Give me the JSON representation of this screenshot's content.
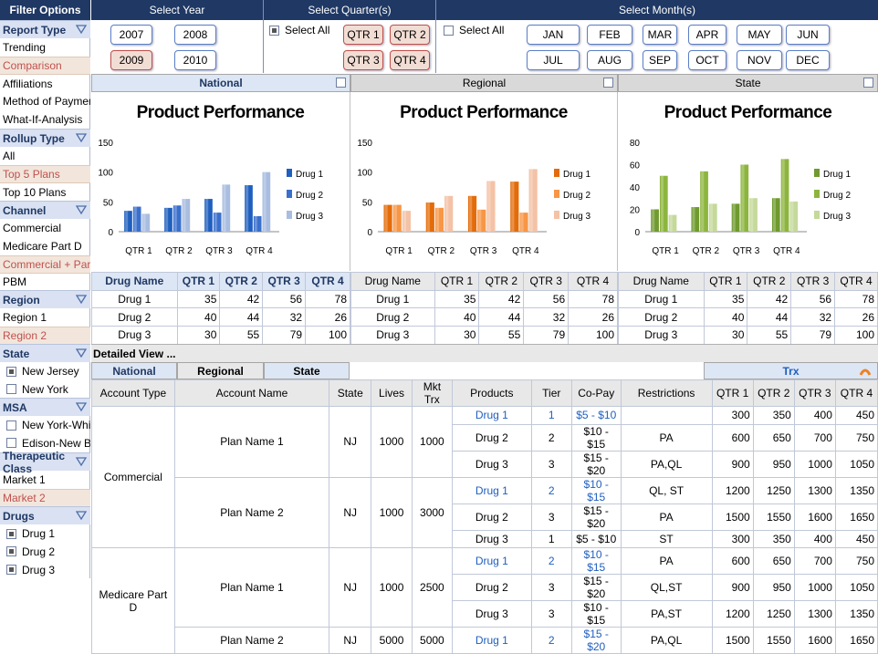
{
  "sidebar": {
    "title": "Filter Options",
    "report_type": {
      "label": "Report Type",
      "items": [
        "Trending",
        "Comparison",
        "Affiliations",
        "Method of Payment",
        "What-If-Analysis"
      ]
    },
    "rollup_type": {
      "label": "Rollup Type",
      "items": [
        "All",
        "Top 5 Plans",
        "Top 10 Plans"
      ]
    },
    "channel": {
      "label": "Channel",
      "items": [
        "Commercial",
        "Medicare Part D",
        "Commercial + Part D",
        "PBM"
      ]
    },
    "region": {
      "label": "Region",
      "items": [
        "Region 1",
        "Region 2"
      ]
    },
    "state": {
      "label": "State",
      "items": [
        "New Jersey",
        "New York"
      ]
    },
    "msa": {
      "label": "MSA",
      "items": [
        "New York-White",
        "Edison-New Bru"
      ]
    },
    "therapeutic": {
      "label": "Therapeutic Class",
      "items": [
        "Market 1",
        "Market 2"
      ]
    },
    "drugs": {
      "label": "Drugs",
      "items": [
        "Drug 1",
        "Drug 2",
        "Drug 3"
      ]
    }
  },
  "filters": {
    "year": {
      "label": "Select Year",
      "options": [
        "2007",
        "2008",
        "2009",
        "2010"
      ]
    },
    "quarter": {
      "label": "Select Quarter(s)",
      "select_all": "Select All",
      "options": [
        "QTR 1",
        "QTR 2",
        "QTR 3",
        "QTR 4"
      ]
    },
    "month": {
      "label": "Select Month(s)",
      "select_all": "Select All",
      "options": [
        "JAN",
        "FEB",
        "MAR",
        "APR",
        "MAY",
        "JUN",
        "JUL",
        "AUG",
        "SEP",
        "OCT",
        "NOV",
        "DEC"
      ]
    }
  },
  "panels": [
    "National",
    "Regional",
    "State"
  ],
  "chart_data": [
    {
      "type": "bar",
      "title": "Product Performance",
      "categories": [
        "QTR 1",
        "QTR 2",
        "QTR 3",
        "QTR 4"
      ],
      "ylim": [
        0,
        150
      ],
      "yticks": [
        0,
        50,
        100,
        150
      ],
      "series": [
        {
          "name": "Drug 1",
          "values": [
            35,
            40,
            55,
            78
          ]
        },
        {
          "name": "Drug 2",
          "values": [
            42,
            44,
            32,
            26
          ]
        },
        {
          "name": "Drug 3",
          "values": [
            30,
            55,
            79,
            100
          ]
        }
      ],
      "colors": [
        "#1f5fbf",
        "#3a6fcc",
        "#a9bde0"
      ]
    },
    {
      "type": "bar",
      "title": "Product Performance",
      "categories": [
        "QTR 1",
        "QTR 2",
        "QTR 3",
        "QTR 4"
      ],
      "ylim": [
        0,
        150
      ],
      "yticks": [
        0,
        50,
        100,
        150
      ],
      "series": [
        {
          "name": "Drug 1",
          "values": [
            45,
            49,
            60,
            84
          ]
        },
        {
          "name": "Drug 2",
          "values": [
            45,
            40,
            37,
            32
          ]
        },
        {
          "name": "Drug 3",
          "values": [
            35,
            60,
            85,
            105
          ]
        }
      ],
      "colors": [
        "#e36c0a",
        "#f79646",
        "#f4c2a6"
      ]
    },
    {
      "type": "bar",
      "title": "Product Performance",
      "categories": [
        "QTR 1",
        "QTR 2",
        "QTR 3",
        "QTR 4"
      ],
      "ylim": [
        0,
        80
      ],
      "yticks": [
        0,
        20,
        40,
        60,
        80
      ],
      "series": [
        {
          "name": "Drug 1",
          "values": [
            20,
            22,
            25,
            30
          ]
        },
        {
          "name": "Drug 2",
          "values": [
            50,
            54,
            60,
            65
          ]
        },
        {
          "name": "Drug 3",
          "values": [
            15,
            25,
            30,
            27
          ]
        }
      ],
      "colors": [
        "#6f9a2f",
        "#8db53e",
        "#c4d99a"
      ]
    }
  ],
  "summary": {
    "headers": [
      "Drug Name",
      "QTR 1",
      "QTR 2",
      "QTR 3",
      "QTR 4"
    ],
    "rows": [
      [
        "Drug 1",
        "35",
        "42",
        "56",
        "78"
      ],
      [
        "Drug 2",
        "40",
        "44",
        "32",
        "26"
      ],
      [
        "Drug 3",
        "30",
        "55",
        "79",
        "100"
      ]
    ]
  },
  "detail": {
    "title": "Detailed View ...",
    "tabs": [
      "National",
      "Regional",
      "State"
    ],
    "trx_label": "Trx",
    "headers": [
      "Account Type",
      "Account Name",
      "State",
      "Lives",
      "Mkt Trx",
      "Products",
      "Tier",
      "Co-Pay",
      "Restrictions",
      "QTR 1",
      "QTR 2",
      "QTR 3",
      "QTR 4"
    ],
    "groups": [
      {
        "type": "Commercial",
        "plans": [
          {
            "name": "Plan Name 1",
            "state": "NJ",
            "lives": "1000",
            "mkt": "1000",
            "rows": [
              [
                "Drug 1",
                "1",
                "$5 - $10",
                "",
                "300",
                "350",
                "400",
                "450"
              ],
              [
                "Drug 2",
                "2",
                "$10 - $15",
                "PA",
                "600",
                "650",
                "700",
                "750"
              ],
              [
                "Drug 3",
                "3",
                "$15 - $20",
                "PA,QL",
                "900",
                "950",
                "1000",
                "1050"
              ]
            ]
          },
          {
            "name": "Plan Name 2",
            "state": "NJ",
            "lives": "1000",
            "mkt": "3000",
            "rows": [
              [
                "Drug 1",
                "2",
                "$10 - $15",
                "QL, ST",
                "1200",
                "1250",
                "1300",
                "1350"
              ],
              [
                "Drug 2",
                "3",
                "$15 - $20",
                "PA",
                "1500",
                "1550",
                "1600",
                "1650"
              ],
              [
                "Drug 3",
                "1",
                "$5 - $10",
                "ST",
                "300",
                "350",
                "400",
                "450"
              ]
            ]
          }
        ]
      },
      {
        "type": "Medicare Part D",
        "plans": [
          {
            "name": "Plan Name 1",
            "state": "NJ",
            "lives": "1000",
            "mkt": "2500",
            "rows": [
              [
                "Drug 1",
                "2",
                "$10 - $15",
                "PA",
                "600",
                "650",
                "700",
                "750"
              ],
              [
                "Drug 2",
                "3",
                "$15 - $20",
                "QL,ST",
                "900",
                "950",
                "1000",
                "1050"
              ],
              [
                "Drug 3",
                "3",
                "$10 - $15",
                "PA,ST",
                "1200",
                "1250",
                "1300",
                "1350"
              ]
            ]
          },
          {
            "name": "Plan Name 2",
            "state": "NJ",
            "lives": "5000",
            "mkt": "5000",
            "rows": [
              [
                "Drug 1",
                "2",
                "$15 - $20",
                "PA,QL",
                "1500",
                "1550",
                "1600",
                "1650"
              ]
            ]
          }
        ]
      }
    ]
  }
}
